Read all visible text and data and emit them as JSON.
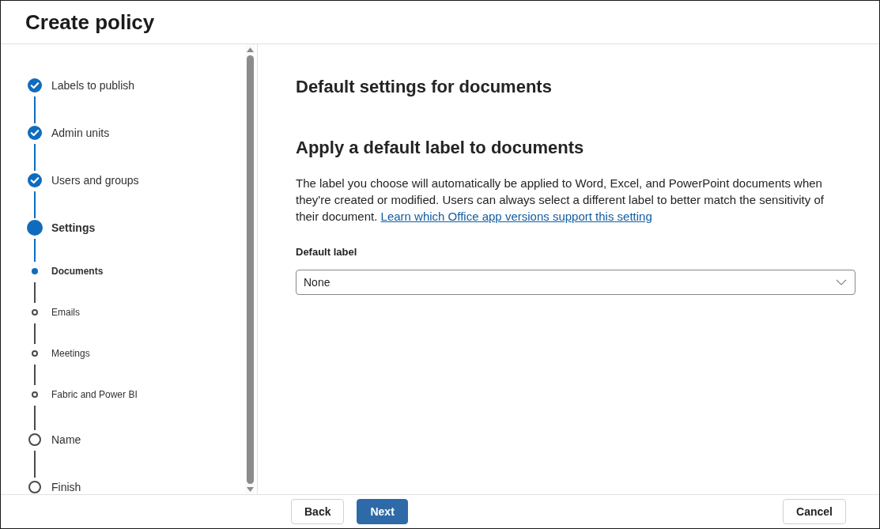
{
  "window": {
    "title": "Create policy"
  },
  "steps": [
    {
      "label": "Labels to publish",
      "completed": true,
      "current": false
    },
    {
      "label": "Admin units",
      "completed": true,
      "current": false
    },
    {
      "label": "Users and groups",
      "completed": true,
      "current": false
    },
    {
      "label": "Settings",
      "completed": false,
      "current": true,
      "children": [
        {
          "label": "Documents",
          "completed": false,
          "current": true
        },
        {
          "label": "Emails",
          "completed": false,
          "current": false
        },
        {
          "label": "Meetings",
          "completed": false,
          "current": false
        },
        {
          "label": "Fabric and Power BI",
          "completed": false,
          "current": false
        }
      ]
    },
    {
      "label": "Name",
      "completed": false,
      "current": false
    },
    {
      "label": "Finish",
      "completed": false,
      "current": false
    }
  ],
  "content": {
    "page_title": "Default settings for documents",
    "section_title": "Apply a default label to documents",
    "description": "The label you choose will automatically be applied to Word, Excel, and PowerPoint documents when they're created or modified. Users can always select a different label to better match the sensitivity of their document.",
    "link": "Learn which Office app versions support this setting",
    "field": {
      "label": "Default label",
      "value": "None"
    }
  },
  "footer": {
    "back": "Back",
    "next": "Next",
    "cancel": "Cancel"
  }
}
